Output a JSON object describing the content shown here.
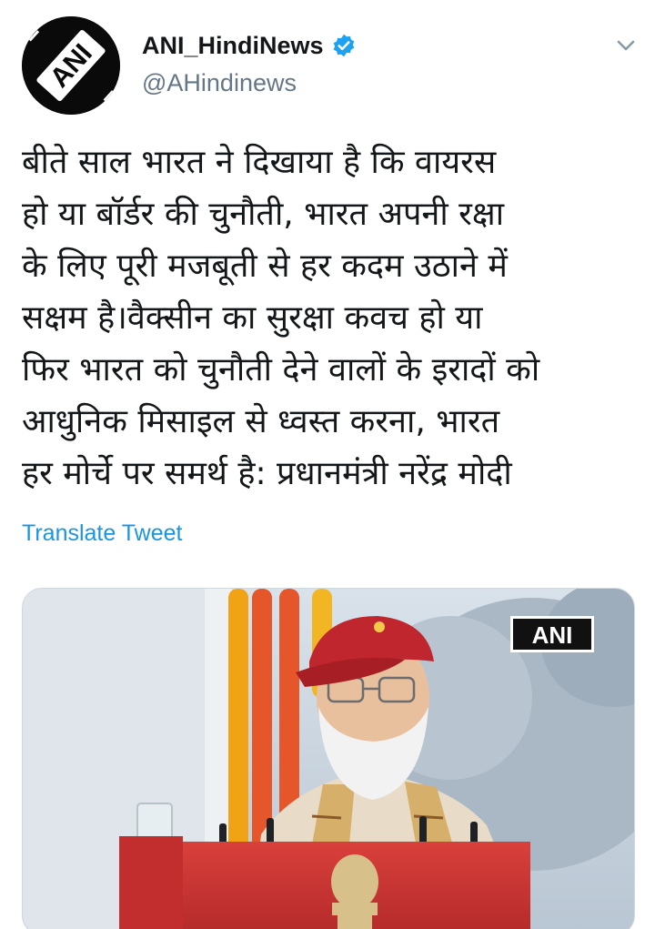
{
  "tweet": {
    "author": {
      "display_name": "ANI_HindiNews",
      "handle": "@AHindinews",
      "verified": true,
      "avatar_logo": "ANI"
    },
    "text_lines": [
      "बीते साल भारत ने दिखाया है कि वायरस",
      "हो या बॉर्डर की चुनौती, भारत अपनी रक्षा",
      "के लिए पूरी मजबूती से हर कदम उठाने में",
      "सक्षम है।वैक्सीन का सुरक्षा कवच हो या",
      "फिर भारत को चुनौती देने वालों के इरादों को",
      "आधुनिक मिसाइल से ध्वस्त करना, भारत",
      "हर मोर्चे पर समर्थ है: प्रधानमंत्री नरेंद्र मोदी"
    ],
    "translate_label": "Translate Tweet",
    "media": {
      "watermark": "ANI"
    }
  },
  "icons": {
    "verified": "verified-badge-icon",
    "menu": "chevron-down-icon"
  },
  "colors": {
    "link": "#1b95e0",
    "verified": "#1da1f2",
    "secondary_text": "#657786",
    "primary_text": "#14171a"
  }
}
